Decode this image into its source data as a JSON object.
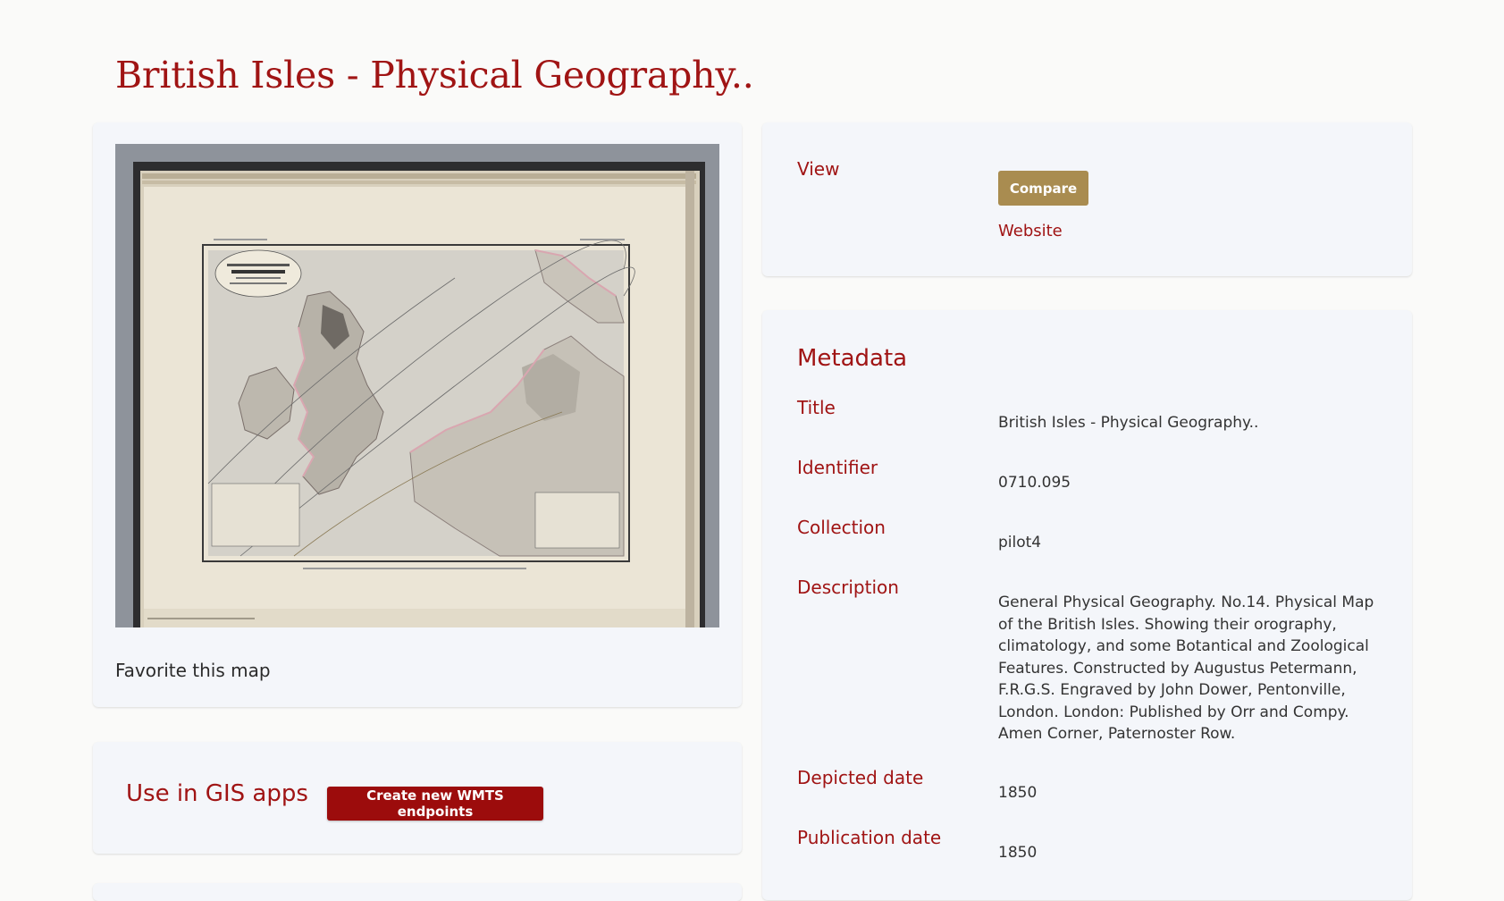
{
  "page": {
    "title": "British Isles - Physical Geography.."
  },
  "image_card": {
    "favorite_label": "Favorite this map"
  },
  "gis": {
    "title": "Use in GIS apps",
    "button_label": "Create new WMTS endpoints"
  },
  "view": {
    "label": "View",
    "compare_label": "Compare",
    "website_label": "Website"
  },
  "metadata": {
    "heading": "Metadata",
    "fields": [
      {
        "label": "Title",
        "value": "British Isles - Physical Geography.."
      },
      {
        "label": "Identifier",
        "value": "0710.095"
      },
      {
        "label": "Collection",
        "value": "pilot4"
      },
      {
        "label": "Description",
        "value": "General Physical Geography. No.14. Physical Map of the British Isles. Showing their orography, climatology, and some Botantical and Zoological Features. Constructed by Augustus Petermann, F.R.G.S. Engraved by John Dower, Pentonville, London. London: Published by Orr and Compy. Amen Corner, Paternoster Row."
      },
      {
        "label": "Depicted date",
        "value": "1850"
      },
      {
        "label": "Publication date",
        "value": "1850"
      }
    ]
  },
  "colors": {
    "accent": "#a01414",
    "button_primary": "#9c0c0c",
    "button_secondary": "#a98c50",
    "card_bg": "#f4f6fa"
  }
}
